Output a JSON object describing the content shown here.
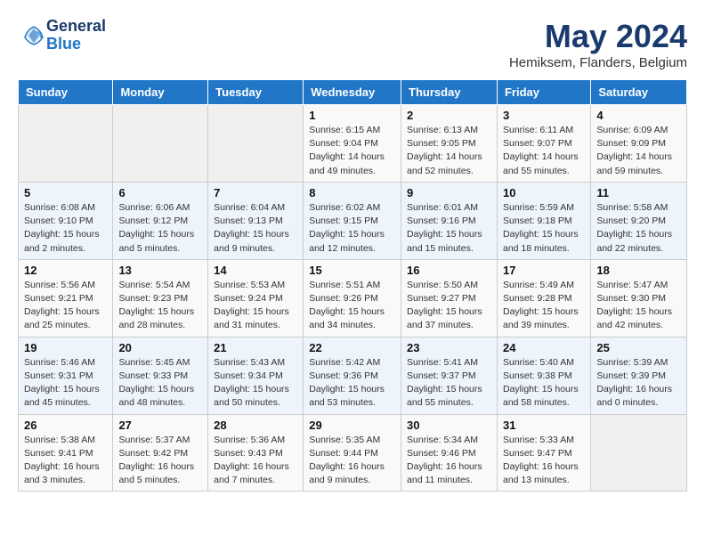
{
  "header": {
    "logo_line1": "General",
    "logo_line2": "Blue",
    "month_title": "May 2024",
    "subtitle": "Hemiksem, Flanders, Belgium"
  },
  "days_of_week": [
    "Sunday",
    "Monday",
    "Tuesday",
    "Wednesday",
    "Thursday",
    "Friday",
    "Saturday"
  ],
  "weeks": [
    [
      {
        "day": "",
        "info": ""
      },
      {
        "day": "",
        "info": ""
      },
      {
        "day": "",
        "info": ""
      },
      {
        "day": "1",
        "info": "Sunrise: 6:15 AM\nSunset: 9:04 PM\nDaylight: 14 hours\nand 49 minutes."
      },
      {
        "day": "2",
        "info": "Sunrise: 6:13 AM\nSunset: 9:05 PM\nDaylight: 14 hours\nand 52 minutes."
      },
      {
        "day": "3",
        "info": "Sunrise: 6:11 AM\nSunset: 9:07 PM\nDaylight: 14 hours\nand 55 minutes."
      },
      {
        "day": "4",
        "info": "Sunrise: 6:09 AM\nSunset: 9:09 PM\nDaylight: 14 hours\nand 59 minutes."
      }
    ],
    [
      {
        "day": "5",
        "info": "Sunrise: 6:08 AM\nSunset: 9:10 PM\nDaylight: 15 hours\nand 2 minutes."
      },
      {
        "day": "6",
        "info": "Sunrise: 6:06 AM\nSunset: 9:12 PM\nDaylight: 15 hours\nand 5 minutes."
      },
      {
        "day": "7",
        "info": "Sunrise: 6:04 AM\nSunset: 9:13 PM\nDaylight: 15 hours\nand 9 minutes."
      },
      {
        "day": "8",
        "info": "Sunrise: 6:02 AM\nSunset: 9:15 PM\nDaylight: 15 hours\nand 12 minutes."
      },
      {
        "day": "9",
        "info": "Sunrise: 6:01 AM\nSunset: 9:16 PM\nDaylight: 15 hours\nand 15 minutes."
      },
      {
        "day": "10",
        "info": "Sunrise: 5:59 AM\nSunset: 9:18 PM\nDaylight: 15 hours\nand 18 minutes."
      },
      {
        "day": "11",
        "info": "Sunrise: 5:58 AM\nSunset: 9:20 PM\nDaylight: 15 hours\nand 22 minutes."
      }
    ],
    [
      {
        "day": "12",
        "info": "Sunrise: 5:56 AM\nSunset: 9:21 PM\nDaylight: 15 hours\nand 25 minutes."
      },
      {
        "day": "13",
        "info": "Sunrise: 5:54 AM\nSunset: 9:23 PM\nDaylight: 15 hours\nand 28 minutes."
      },
      {
        "day": "14",
        "info": "Sunrise: 5:53 AM\nSunset: 9:24 PM\nDaylight: 15 hours\nand 31 minutes."
      },
      {
        "day": "15",
        "info": "Sunrise: 5:51 AM\nSunset: 9:26 PM\nDaylight: 15 hours\nand 34 minutes."
      },
      {
        "day": "16",
        "info": "Sunrise: 5:50 AM\nSunset: 9:27 PM\nDaylight: 15 hours\nand 37 minutes."
      },
      {
        "day": "17",
        "info": "Sunrise: 5:49 AM\nSunset: 9:28 PM\nDaylight: 15 hours\nand 39 minutes."
      },
      {
        "day": "18",
        "info": "Sunrise: 5:47 AM\nSunset: 9:30 PM\nDaylight: 15 hours\nand 42 minutes."
      }
    ],
    [
      {
        "day": "19",
        "info": "Sunrise: 5:46 AM\nSunset: 9:31 PM\nDaylight: 15 hours\nand 45 minutes."
      },
      {
        "day": "20",
        "info": "Sunrise: 5:45 AM\nSunset: 9:33 PM\nDaylight: 15 hours\nand 48 minutes."
      },
      {
        "day": "21",
        "info": "Sunrise: 5:43 AM\nSunset: 9:34 PM\nDaylight: 15 hours\nand 50 minutes."
      },
      {
        "day": "22",
        "info": "Sunrise: 5:42 AM\nSunset: 9:36 PM\nDaylight: 15 hours\nand 53 minutes."
      },
      {
        "day": "23",
        "info": "Sunrise: 5:41 AM\nSunset: 9:37 PM\nDaylight: 15 hours\nand 55 minutes."
      },
      {
        "day": "24",
        "info": "Sunrise: 5:40 AM\nSunset: 9:38 PM\nDaylight: 15 hours\nand 58 minutes."
      },
      {
        "day": "25",
        "info": "Sunrise: 5:39 AM\nSunset: 9:39 PM\nDaylight: 16 hours\nand 0 minutes."
      }
    ],
    [
      {
        "day": "26",
        "info": "Sunrise: 5:38 AM\nSunset: 9:41 PM\nDaylight: 16 hours\nand 3 minutes."
      },
      {
        "day": "27",
        "info": "Sunrise: 5:37 AM\nSunset: 9:42 PM\nDaylight: 16 hours\nand 5 minutes."
      },
      {
        "day": "28",
        "info": "Sunrise: 5:36 AM\nSunset: 9:43 PM\nDaylight: 16 hours\nand 7 minutes."
      },
      {
        "day": "29",
        "info": "Sunrise: 5:35 AM\nSunset: 9:44 PM\nDaylight: 16 hours\nand 9 minutes."
      },
      {
        "day": "30",
        "info": "Sunrise: 5:34 AM\nSunset: 9:46 PM\nDaylight: 16 hours\nand 11 minutes."
      },
      {
        "day": "31",
        "info": "Sunrise: 5:33 AM\nSunset: 9:47 PM\nDaylight: 16 hours\nand 13 minutes."
      },
      {
        "day": "",
        "info": ""
      }
    ]
  ]
}
